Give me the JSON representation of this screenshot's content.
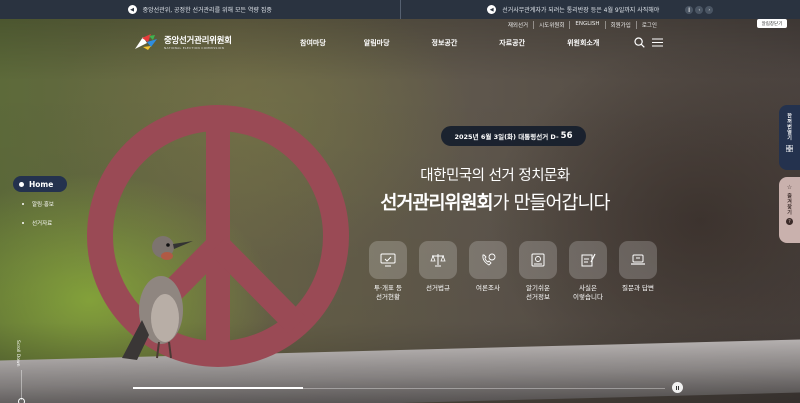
{
  "notices": [
    {
      "icon": "megaphone-icon",
      "text": "중앙선관위, 공정한 선거관리를 위해 모든 역량 집중"
    },
    {
      "icon": "megaphone-icon",
      "text": "선거사무관계자가 되려는 통리반장 등은 4월 9일까지 사직해야"
    }
  ],
  "notice_controls": [
    "prev",
    "pause",
    "next"
  ],
  "util_links": [
    "재외선거",
    "시도위원회",
    "ENGLISH",
    "회원가입",
    "로그인"
  ],
  "sitemap_label": "알림창닫기",
  "logo": {
    "ko": "중앙선거관리위원회",
    "en": "NATIONAL ELECTION COMMISSION"
  },
  "gnb": [
    "참여마당",
    "알림마당",
    "정보공간",
    "자료공간",
    "위원회소개"
  ],
  "dday": {
    "text": "2025년 6월 3일(화) 대통령선거 D-",
    "num": "56"
  },
  "hero": {
    "line1": "대한민국의 선거 정치문화",
    "line2_bold": "선거관리위원회",
    "line2_rest": "가 만들어갑니다"
  },
  "quick_menu": [
    {
      "icon": "monitor-vote-icon",
      "label": "투·개표 등\n선거현황"
    },
    {
      "icon": "scales-icon",
      "label": "선거법규"
    },
    {
      "icon": "phone-survey-icon",
      "label": "여론조사"
    },
    {
      "icon": "guide-book-icon",
      "label": "알기쉬운\n선거정보"
    },
    {
      "icon": "fact-check-icon",
      "label": "사실은\n이렇습니다"
    },
    {
      "icon": "laptop-qa-icon",
      "label": "질문과 답변"
    }
  ],
  "side_nav": {
    "home": "Home",
    "items": [
      "알림·홍보",
      "선거자료"
    ]
  },
  "scroll_down": "Scroll Down",
  "slide_progress": 0.32,
  "right_tabs": {
    "open": "한꺼번열기",
    "fav": "즐겨찾기"
  },
  "colors": {
    "navy": "#24324e",
    "notice_bg": "#2a3340",
    "peace_red": "#9a4a55",
    "fav_tab": "#c9b1ad"
  }
}
